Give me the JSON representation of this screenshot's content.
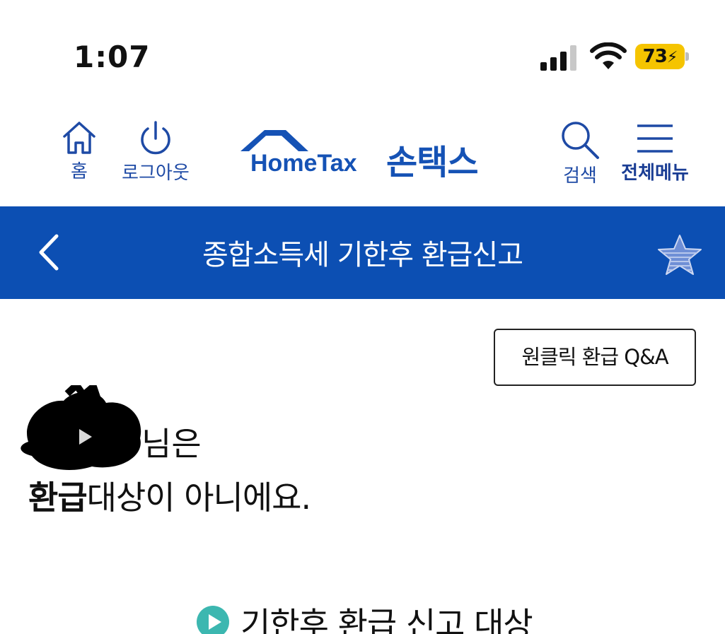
{
  "status_bar": {
    "time": "1:07",
    "battery_level": "73",
    "battery_color": "#f5c400"
  },
  "header": {
    "home_label": "홈",
    "logout_label": "로그아웃",
    "logo_en": "HomeTax",
    "logo_ko": "손택스",
    "search_label": "검색",
    "menu_label": "전체메뉴",
    "brand_color": "#1552b5"
  },
  "title_bar": {
    "title": "종합소득세 기한후 환급신고",
    "background": "#0c4fb3"
  },
  "content": {
    "qa_button": "원클릭 환급 Q&A",
    "user_suffix": "님은",
    "result_strong": "환급",
    "result_rest": "대상이 아니에요.",
    "section_title": "기한후 환급 신고 대상"
  },
  "icons": {
    "home": "home-icon",
    "logout": "power-icon",
    "search": "search-icon",
    "menu": "hamburger-menu-icon",
    "back": "chevron-left-icon",
    "favorite": "star-icon",
    "section": "play-circle-icon"
  }
}
